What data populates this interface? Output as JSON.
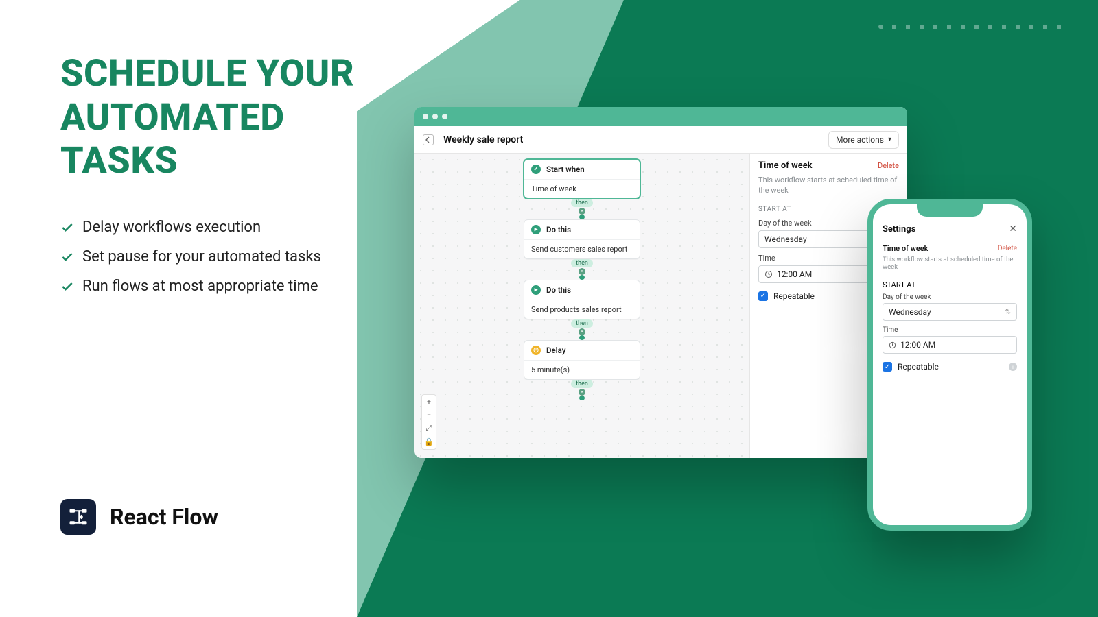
{
  "hero": {
    "line1": "SCHEDULE YOUR",
    "line2": "AUTOMATED",
    "line3": "TASKS"
  },
  "bullets": [
    "Delay workflows execution",
    "Set pause for your automated tasks",
    "Run flows at most appropriate time"
  ],
  "brand": {
    "name": "React Flow"
  },
  "browser": {
    "title": "Weekly sale report",
    "more_actions": "More actions",
    "flow": [
      {
        "icon": "check",
        "head": "Start when",
        "body": "Time of week",
        "selected": true
      },
      {
        "icon": "play",
        "head": "Do this",
        "body": "Send customers sales report"
      },
      {
        "icon": "play",
        "head": "Do this",
        "body": "Send products sales report"
      },
      {
        "icon": "clock",
        "head": "Delay",
        "body": "5 minute(s)"
      }
    ],
    "connector_label": "then",
    "zoom": {
      "plus": "+",
      "minus": "−",
      "fit": "⤢",
      "lock": "🔒"
    },
    "panel": {
      "title": "Time of week",
      "delete": "Delete",
      "subtitle": "This workflow starts at scheduled time of the week",
      "section": "START AT",
      "day_label": "Day of the week",
      "day_value": "Wednesday",
      "time_label": "Time",
      "time_value": "12:00 AM",
      "repeatable": "Repeatable"
    }
  },
  "phone": {
    "title": "Settings",
    "close": "✕",
    "card_title": "Time of week",
    "delete": "Delete",
    "subtitle": "This workflow starts at scheduled time of the week",
    "section": "START AT",
    "day_label": "Day of the week",
    "day_value": "Wednesday",
    "time_label": "Time",
    "time_value": "12:00 AM",
    "repeatable": "Repeatable"
  }
}
